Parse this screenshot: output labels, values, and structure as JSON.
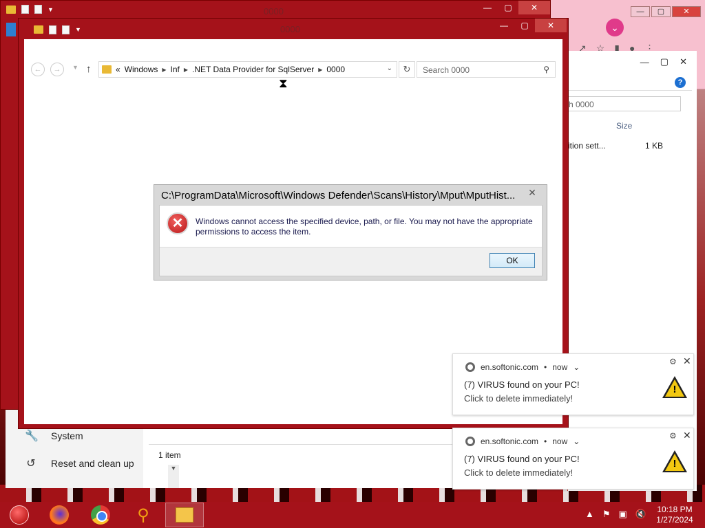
{
  "desktop": {
    "accent": "#a5121a"
  },
  "chrome_window": {
    "min": "—",
    "max": "▢",
    "close": "✕"
  },
  "explorer_back": {
    "min": "—",
    "max": "▢",
    "close": "✕",
    "search_placeholder": "h 0000",
    "column_size": "Size",
    "row_name": "ition sett...",
    "row_size": "1 KB"
  },
  "settings_window": {
    "items": [
      {
        "label": "System",
        "icon": "wrench-icon"
      },
      {
        "label": "Reset and clean up",
        "icon": "history-icon"
      }
    ],
    "status": "1 item"
  },
  "explorer_main": {
    "title": "0000",
    "breadcrumb": [
      "Windows",
      "Inf",
      ".NET Data Provider for SqlServer",
      "0000"
    ],
    "breadcrumb_prefix": "«",
    "search_placeholder": "Search 0000"
  },
  "dialog": {
    "title": "C:\\ProgramData\\Microsoft\\Windows Defender\\Scans\\History\\Mput\\MputHist...",
    "message": "Windows cannot access the specified device, path, or file. You may not have the appropriate permissions to access the item.",
    "ok_label": "OK",
    "close_label": "✕"
  },
  "toasts": [
    {
      "source": "en.softonic.com",
      "time": "now",
      "line1": "(7) VIRUS found on your PC!",
      "line2": "Click to delete immediately!"
    },
    {
      "source": "en.softonic.com",
      "time": "now",
      "line1": "(7) VIRUS found on your PC!",
      "line2": "Click to delete immediately!"
    }
  ],
  "taskbar": {
    "time": "10:18 PM",
    "date": "1/27/2024"
  }
}
